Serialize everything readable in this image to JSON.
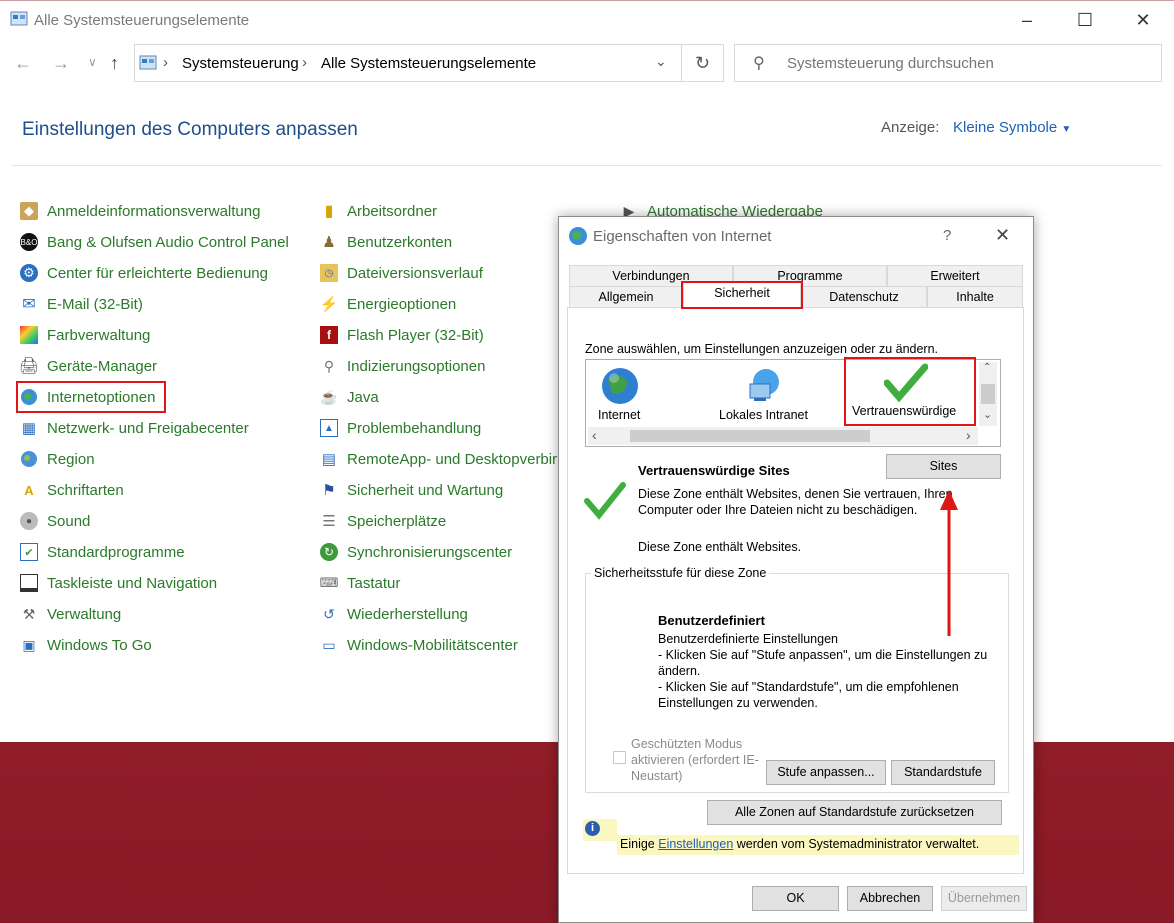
{
  "window": {
    "title": "Alle Systemsteuerungselemente",
    "address": [
      "Systemsteuerung",
      "Alle Systemsteuerungselemente"
    ],
    "search_placeholder": "Systemsteuerung durchsuchen",
    "heading": "Einstellungen des Computers anpassen",
    "view_label": "Anzeige:",
    "view_value": "Kleine Symbole"
  },
  "items_col1": [
    "Anmeldeinformationsverwaltung",
    "Bang & Olufsen Audio Control Panel",
    "Center für erleichterte Bedienung",
    "E-Mail (32-Bit)",
    "Farbverwaltung",
    "Geräte-Manager",
    "Internetoptionen",
    "Netzwerk- und Freigabecenter",
    "Region",
    "Schriftarten",
    "Sound",
    "Standardprogramme",
    "Taskleiste und Navigation",
    "Verwaltung",
    "Windows To Go"
  ],
  "items_col2": [
    "Arbeitsordner",
    "Benutzerkonten",
    "Dateiversionsverlauf",
    "Energieoptionen",
    "Flash Player (32-Bit)",
    "Indizierungsoptionen",
    "Java",
    "Problembehandlung",
    "RemoteApp- und Desktopverbir",
    "Sicherheit und Wartung",
    "Speicherplätze",
    "Synchronisierungscenter",
    "Tastatur",
    "Wiederherstellung",
    "Windows-Mobilitätscenter"
  ],
  "items_col3": [
    "Automatische Wiedergabe"
  ],
  "dialog": {
    "title": "Eigenschaften von Internet",
    "help": "?",
    "tabs_row1": [
      "Verbindungen",
      "Programme",
      "Erweitert"
    ],
    "tabs_row2": [
      "Allgemein",
      "Sicherheit",
      "Datenschutz",
      "Inhalte"
    ],
    "zone_prompt": "Zone auswählen, um Einstellungen anzuzeigen oder zu ändern.",
    "zones": [
      "Internet",
      "Lokales Intranet",
      "Vertrauenswürdige"
    ],
    "zone_title": "Vertrauenswürdige Sites",
    "zone_desc": "Diese Zone enthält Websites, denen Sie vertrauen, Ihren Computer oder Ihre Dateien nicht zu beschädigen.",
    "zone_desc2": "Diese Zone enthält Websites.",
    "sites_button": "Sites",
    "level_group": "Sicherheitsstufe für diese Zone",
    "level_name": "Benutzerdefiniert",
    "level_lines": [
      "Benutzerdefinierte Einstellungen",
      "- Klicken Sie auf \"Stufe anpassen\", um die Einstellungen zu ändern.",
      "- Klicken Sie auf \"Standardstufe\", um die empfohlenen Einstellungen zu verwenden."
    ],
    "protected_mode": "Geschützten Modus aktivieren (erfordert IE-Neustart)",
    "custom_level_button": "Stufe anpassen...",
    "default_level_button": "Standardstufe",
    "reset_all_button": "Alle Zonen auf Standardstufe zurücksetzen",
    "info_prefix": "Einige ",
    "info_link": "Einstellungen",
    "info_suffix": " werden vom Systemadministrator verwaltet.",
    "ok": "OK",
    "cancel": "Abbrechen",
    "apply": "Übernehmen"
  },
  "colors": {
    "link_green": "#2a7a2a",
    "heading_blue": "#1e4e8c",
    "highlight_red": "#e01616"
  }
}
